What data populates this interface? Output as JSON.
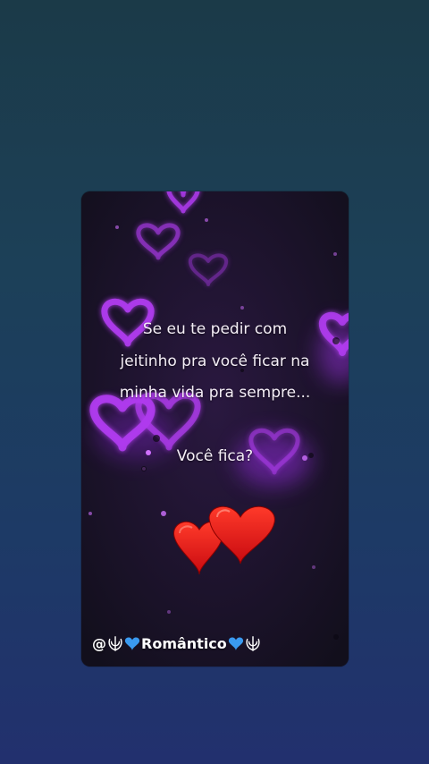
{
  "message": {
    "line1": "Se eu te pedir com",
    "line2": "jeitinho pra você ficar na",
    "line3": "minha vida pra sempre...",
    "line4": "Você fica?"
  },
  "watermark": {
    "prefix": "@",
    "name": "Romântico",
    "icons": [
      "khanda-icon",
      "blue-heart-icon",
      "blue-heart-icon",
      "khanda-icon"
    ]
  },
  "colors": {
    "card_background": "#161222",
    "glow_heart": "#b03cf0",
    "red_heart": "#e01818",
    "blue_heart": "#3a9af0",
    "text": "#f4eef6"
  }
}
